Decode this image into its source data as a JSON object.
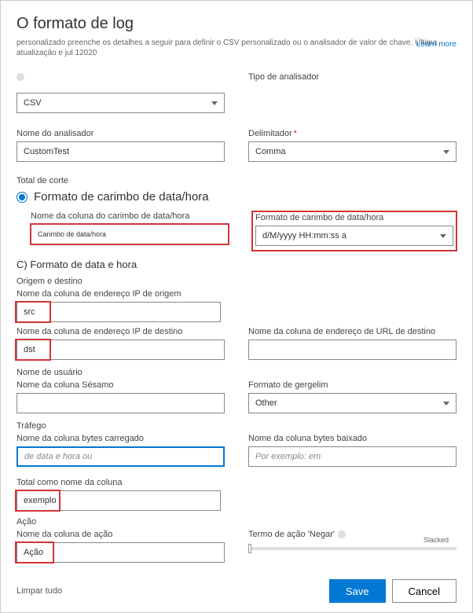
{
  "header": {
    "title": "O formato de log",
    "subtitle": "personalizado preenche os detalhes a seguir para definir o CSV personalizado ou o analisador de valor de chave. Última atualização e jul 12020",
    "learn_more": "Learn more"
  },
  "parser": {
    "type_label": "Tipo de analisador",
    "type_value": "CSV",
    "name_label": "Nome do analisador",
    "name_value": "CustomTest",
    "delimiter_label": "Delimitador",
    "delimiter_value": "Comma"
  },
  "cutoff": {
    "label": "Total de corte",
    "radio_label": "Formato de carimbo de data/hora",
    "ts_col_label": "Nome da coluna do carimbo de data/hora",
    "ts_col_value": "Carimbo de data/hora",
    "ts_fmt_label": "Formato de carimbo de data/hora",
    "ts_fmt_value": "d/M/yyyy HH:mm:ss a"
  },
  "sectionC": {
    "title": "C) Formato de data e hora",
    "origin_dest": "Origem e destino",
    "src_label": "Nome da coluna de endereço IP de origem",
    "src_value": "src",
    "dst_label": "Nome da coluna de endereço IP de destino",
    "dst_value": "dst",
    "url_label": "Nome da coluna de endereço de URL de destino",
    "url_value": "",
    "user_section": "Nome de usuário",
    "sesame_label": "Nome da coluna Sésamo",
    "sesame_value": "",
    "gergelim_label": "Formato de gergelim",
    "gergelim_value": "Other",
    "traffic_section": "Tráfego",
    "bytes_up_label": "Nome da coluna bytes carregado",
    "bytes_up_placeholder": "de data e hora ou",
    "bytes_down_label": "Nome da coluna bytes baixado",
    "bytes_down_placeholder": "Por exemplo: em",
    "total_col_label": "Total como nome da coluna",
    "total_col_value": "exemplo",
    "action_section": "Ação",
    "action_col_label": "Nome da coluna de ação",
    "action_col_value": "Ação",
    "deny_label": "Termo de ação 'Negar'",
    "slider_text": "Slacked"
  },
  "footer": {
    "clear": "Limpar tudo",
    "save": "Save",
    "cancel": "Cancel"
  }
}
